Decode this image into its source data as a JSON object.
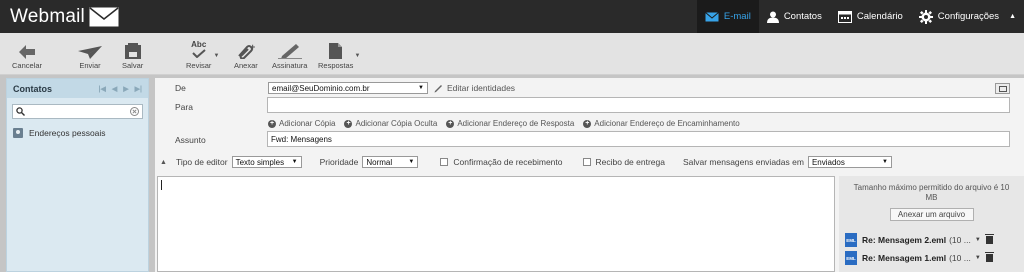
{
  "app": {
    "logo_text": "Webmail"
  },
  "topnav": [
    {
      "label": "E-mail",
      "icon": "envelope-icon",
      "active": true
    },
    {
      "label": "Contatos",
      "icon": "person-icon",
      "active": false
    },
    {
      "label": "Calendário",
      "icon": "calendar-icon",
      "active": false
    },
    {
      "label": "Configurações",
      "icon": "gear-icon",
      "active": false
    }
  ],
  "toolbar": {
    "cancel": "Cancelar",
    "send": "Enviar",
    "save": "Salvar",
    "spell": "Revisar",
    "spell_icon_text": "Abc",
    "attach": "Anexar",
    "signature": "Assinatura",
    "responses": "Respostas"
  },
  "contacts": {
    "title": "Contatos",
    "search_value": "",
    "items": [
      {
        "label": "Endereços pessoais"
      }
    ]
  },
  "compose": {
    "from_label": "De",
    "from_value": "email@SeuDominio.com.br",
    "edit_identities": "Editar identidades",
    "to_label": "Para",
    "to_value": "",
    "add_links": [
      "Adicionar Cópia",
      "Adicionar Cópia Oculta",
      "Adicionar Endereço de Resposta",
      "Adicionar Endereço de Encaminhamento"
    ],
    "subject_label": "Assunto",
    "subject_value": "Fwd: Mensagens",
    "editor_type_label": "Tipo de editor",
    "editor_type_value": "Texto simples",
    "priority_label": "Prioridade",
    "priority_value": "Normal",
    "read_receipt_label": "Confirmação de recebimento",
    "delivery_receipt_label": "Recibo de entrega",
    "save_sent_label": "Salvar mensagens enviadas em",
    "save_sent_value": "Enviados",
    "body_value": ""
  },
  "attachments": {
    "max_size_info": "Tamanho máximo permitido do arquivo é 10 MB",
    "attach_button": "Anexar um arquivo",
    "icon_text": "EML",
    "files": [
      {
        "name": "Re: Mensagem 2.eml",
        "size": "(10 ..."
      },
      {
        "name": "Re: Mensagem 1.eml",
        "size": "(10 ..."
      }
    ]
  },
  "colors": {
    "topbar": "#2a2a2a",
    "accent": "#37a3e8",
    "panel": "#dbe9f1"
  }
}
